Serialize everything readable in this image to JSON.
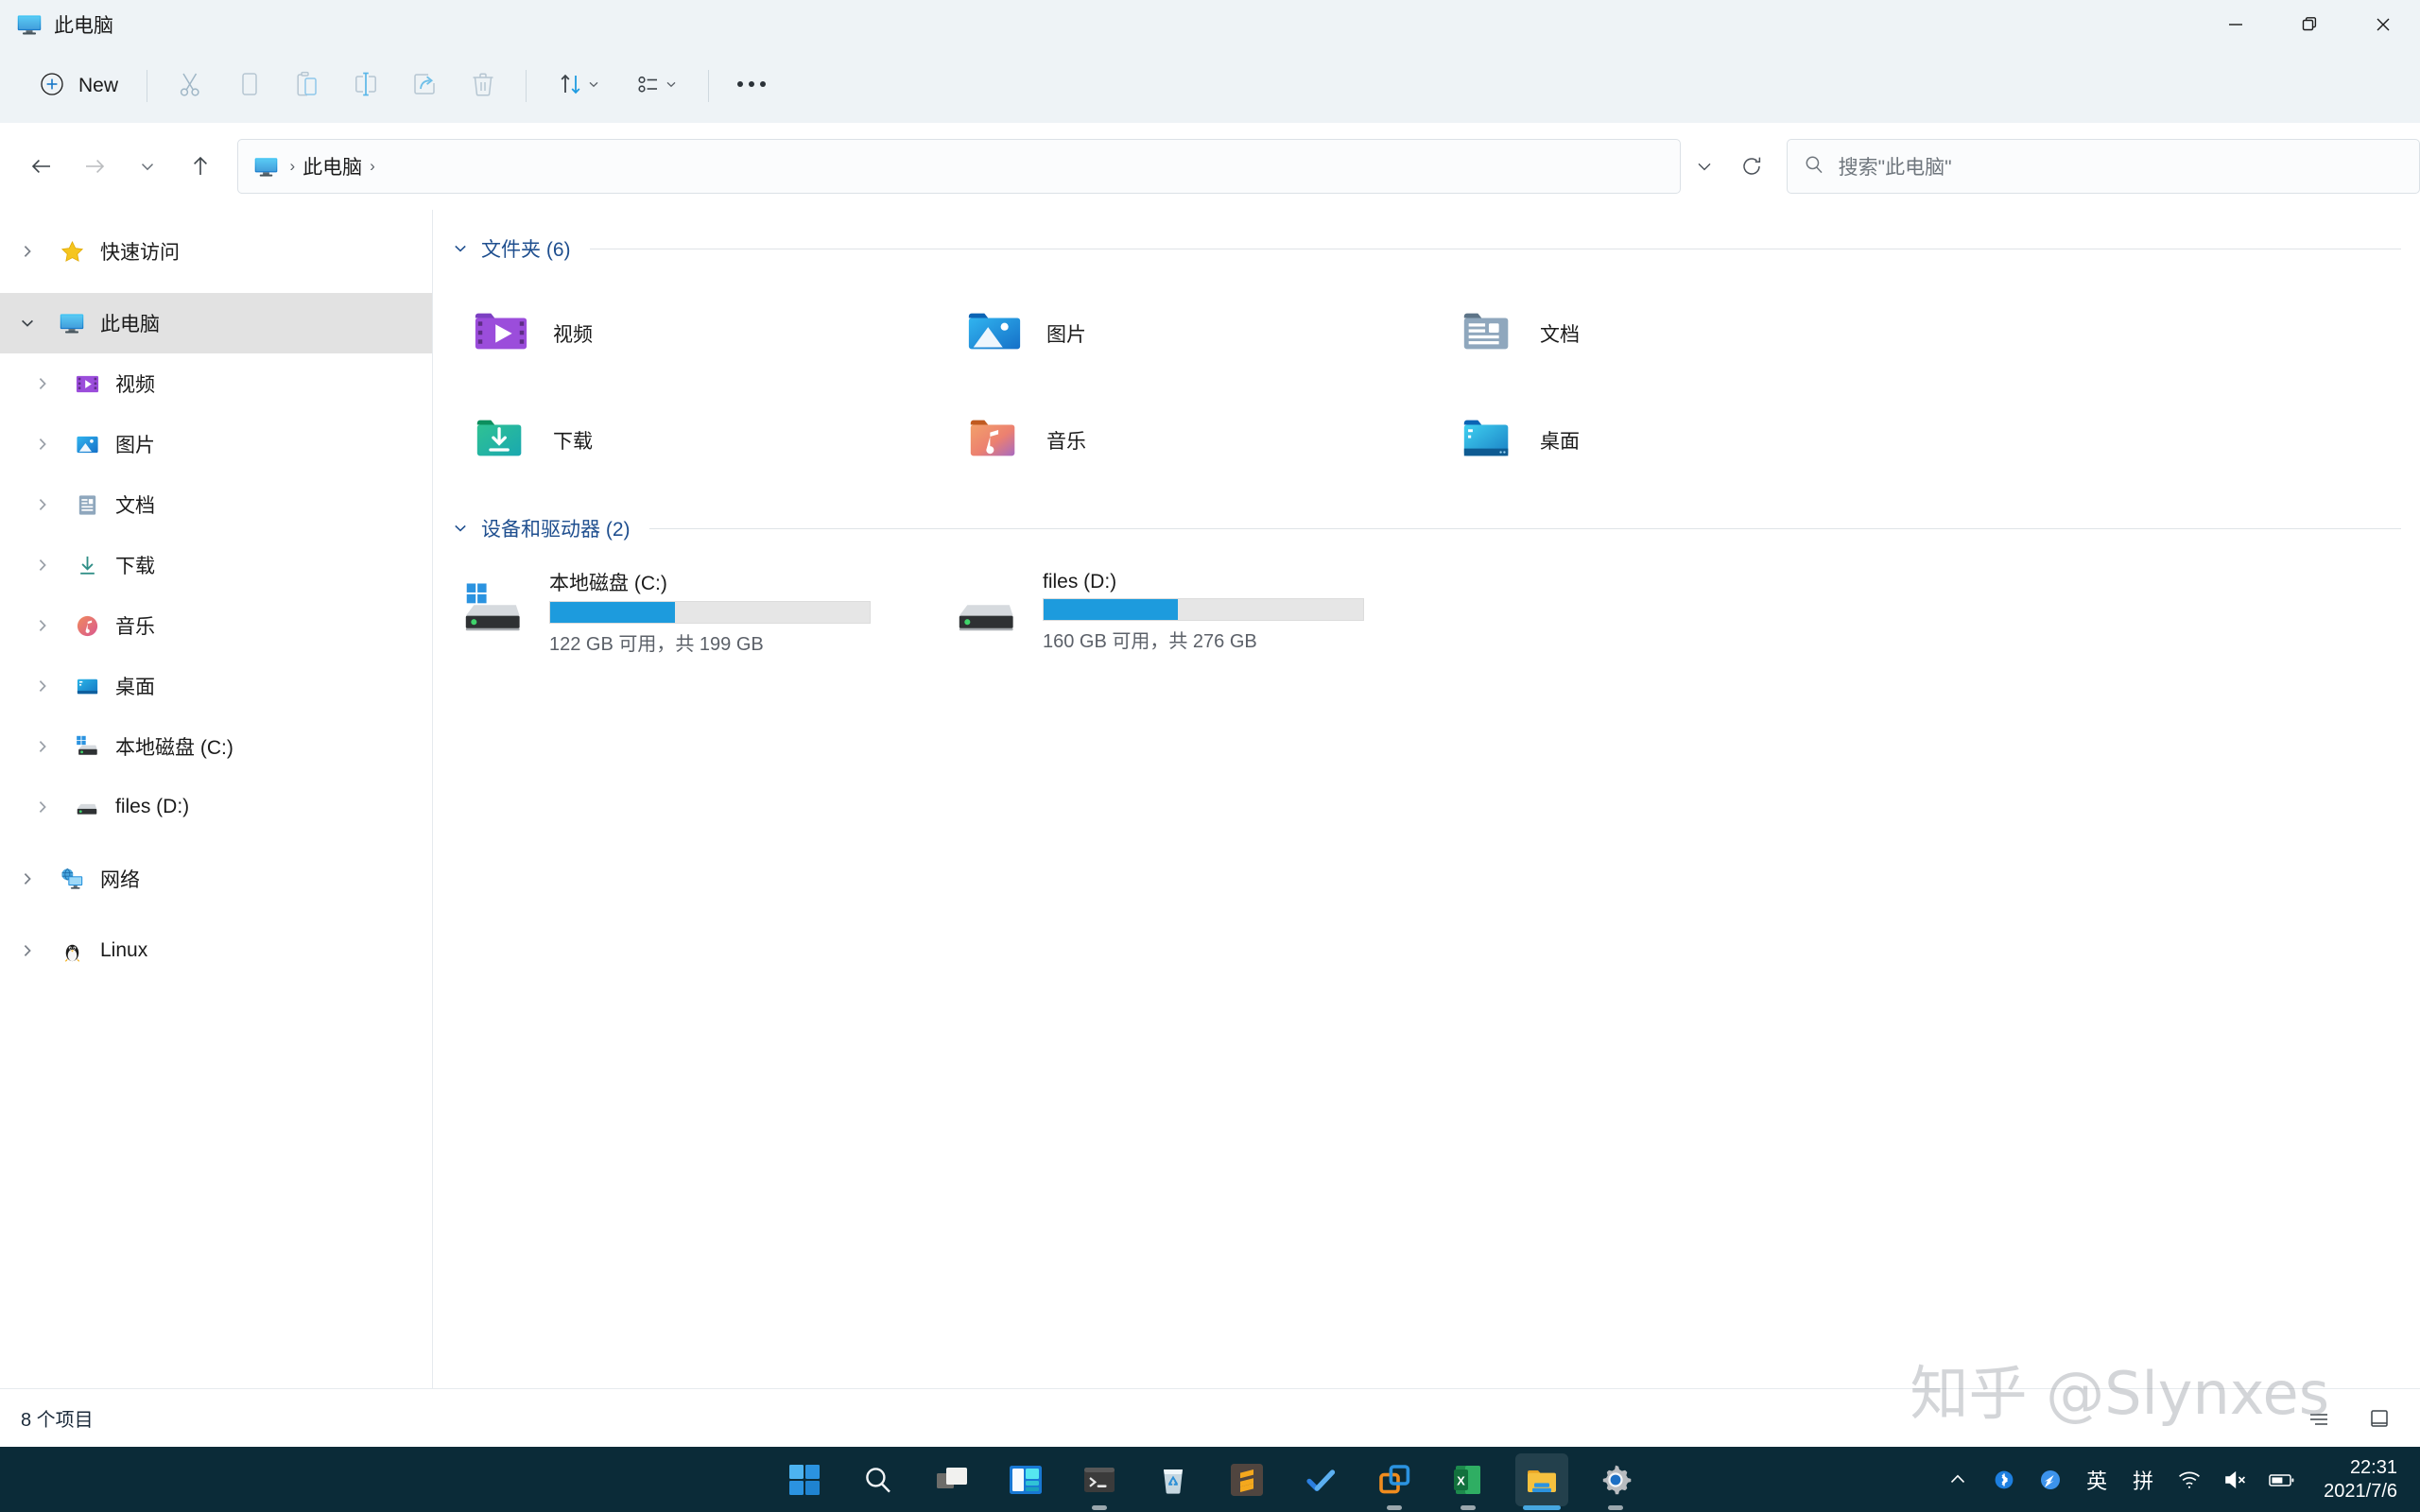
{
  "window": {
    "title": "此电脑",
    "minimize_label": "最小化",
    "maximize_label": "最大化",
    "close_label": "关闭"
  },
  "toolbar": {
    "new_label": "New",
    "cut_label": "剪切",
    "copy_label": "复制",
    "paste_label": "粘贴",
    "rename_label": "重命名",
    "share_label": "共享",
    "delete_label": "删除",
    "sort_label": "排序",
    "view_label": "查看",
    "more_label": "查看更多"
  },
  "navbar": {
    "back_label": "返回",
    "forward_label": "前进",
    "recent_label": "最近的位置",
    "up_label": "向上",
    "breadcrumb": [
      "此电脑"
    ],
    "breadcrumb_separator": "›",
    "history_label": "历史记录",
    "refresh_label": "刷新"
  },
  "search": {
    "placeholder": "搜索\"此电脑\"",
    "value": ""
  },
  "sidebar": {
    "items": [
      {
        "label": "快速访问",
        "icon": "star-icon",
        "level": 0,
        "expanded": false,
        "selected": false
      },
      {
        "label": "此电脑",
        "icon": "this-pc-icon",
        "level": 0,
        "expanded": true,
        "selected": true
      },
      {
        "label": "视频",
        "icon": "videos-folder-icon",
        "level": 1,
        "expanded": false,
        "selected": false
      },
      {
        "label": "图片",
        "icon": "pictures-folder-icon",
        "level": 1,
        "expanded": false,
        "selected": false
      },
      {
        "label": "文档",
        "icon": "documents-folder-icon",
        "level": 1,
        "expanded": false,
        "selected": false
      },
      {
        "label": "下载",
        "icon": "downloads-folder-icon",
        "level": 1,
        "expanded": false,
        "selected": false
      },
      {
        "label": "音乐",
        "icon": "music-folder-icon",
        "level": 1,
        "expanded": false,
        "selected": false
      },
      {
        "label": "桌面",
        "icon": "desktop-folder-icon",
        "level": 1,
        "expanded": false,
        "selected": false
      },
      {
        "label": "本地磁盘 (C:)",
        "icon": "windows-drive-icon",
        "level": 1,
        "expanded": false,
        "selected": false
      },
      {
        "label": "files (D:)",
        "icon": "drive-icon",
        "level": 1,
        "expanded": false,
        "selected": false
      },
      {
        "label": "网络",
        "icon": "network-icon",
        "level": 0,
        "expanded": false,
        "selected": false
      },
      {
        "label": "Linux",
        "icon": "linux-penguin-icon",
        "level": 0,
        "expanded": false,
        "selected": false
      }
    ]
  },
  "main": {
    "groups": [
      {
        "title": "文件夹 (6)",
        "expanded": true
      },
      {
        "title": "设备和驱动器 (2)",
        "expanded": true
      }
    ],
    "folders": [
      {
        "label": "视频",
        "icon": "videos-folder-icon"
      },
      {
        "label": "图片",
        "icon": "pictures-folder-icon"
      },
      {
        "label": "文档",
        "icon": "documents-folder-icon"
      },
      {
        "label": "下载",
        "icon": "downloads-folder-icon"
      },
      {
        "label": "音乐",
        "icon": "music-folder-icon"
      },
      {
        "label": "桌面",
        "icon": "desktop-folder-icon"
      }
    ],
    "drives": [
      {
        "name": "本地磁盘 (C:)",
        "icon": "windows-drive-icon",
        "free_text": "122 GB 可用，共 199 GB",
        "free_gb": 122,
        "total_gb": 199,
        "used_percent": 39,
        "bar_color": "#1d9bdd"
      },
      {
        "name": "files (D:)",
        "icon": "drive-icon",
        "free_text": "160 GB 可用，共 276 GB",
        "free_gb": 160,
        "total_gb": 276,
        "used_percent": 42,
        "bar_color": "#1d9bdd"
      }
    ]
  },
  "statusbar": {
    "item_count_text": "8 个项目",
    "details_view_label": "详细信息视图",
    "large_icons_view_label": "大图标视图"
  },
  "watermark": {
    "text": "知乎 @Slynxes"
  },
  "taskbar": {
    "items": [
      {
        "name": "start-icon",
        "label": "开始",
        "running": false,
        "active": false
      },
      {
        "name": "search-icon",
        "label": "搜索",
        "running": false,
        "active": false
      },
      {
        "name": "task-view-icon",
        "label": "任务视图",
        "running": false,
        "active": false
      },
      {
        "name": "widgets-icon",
        "label": "小组件",
        "running": false,
        "active": false
      },
      {
        "name": "terminal-icon",
        "label": "终端",
        "running": true,
        "active": false
      },
      {
        "name": "recycle-bin-icon",
        "label": "回收站",
        "running": false,
        "active": false
      },
      {
        "name": "sublime-text-icon",
        "label": "Sublime Text",
        "running": false,
        "active": false
      },
      {
        "name": "todo-icon",
        "label": "待办事项",
        "running": false,
        "active": false
      },
      {
        "name": "vmware-icon",
        "label": "VMware",
        "running": true,
        "active": false
      },
      {
        "name": "excel-icon",
        "label": "Excel",
        "running": true,
        "active": false
      },
      {
        "name": "file-explorer-icon",
        "label": "文件资源管理器",
        "running": true,
        "active": true
      },
      {
        "name": "settings-icon",
        "label": "设置",
        "running": true,
        "active": false
      }
    ],
    "tray": {
      "overflow_label": "显示隐藏的图标",
      "bluetooth_label": "蓝牙",
      "app_label": "应用",
      "ime_mode": "英",
      "ime_pinyin": "拼",
      "network_label": "网络",
      "volume_label": "音量（静音）",
      "battery_label": "电池",
      "time": "22:31",
      "date": "2021/7/6"
    }
  }
}
